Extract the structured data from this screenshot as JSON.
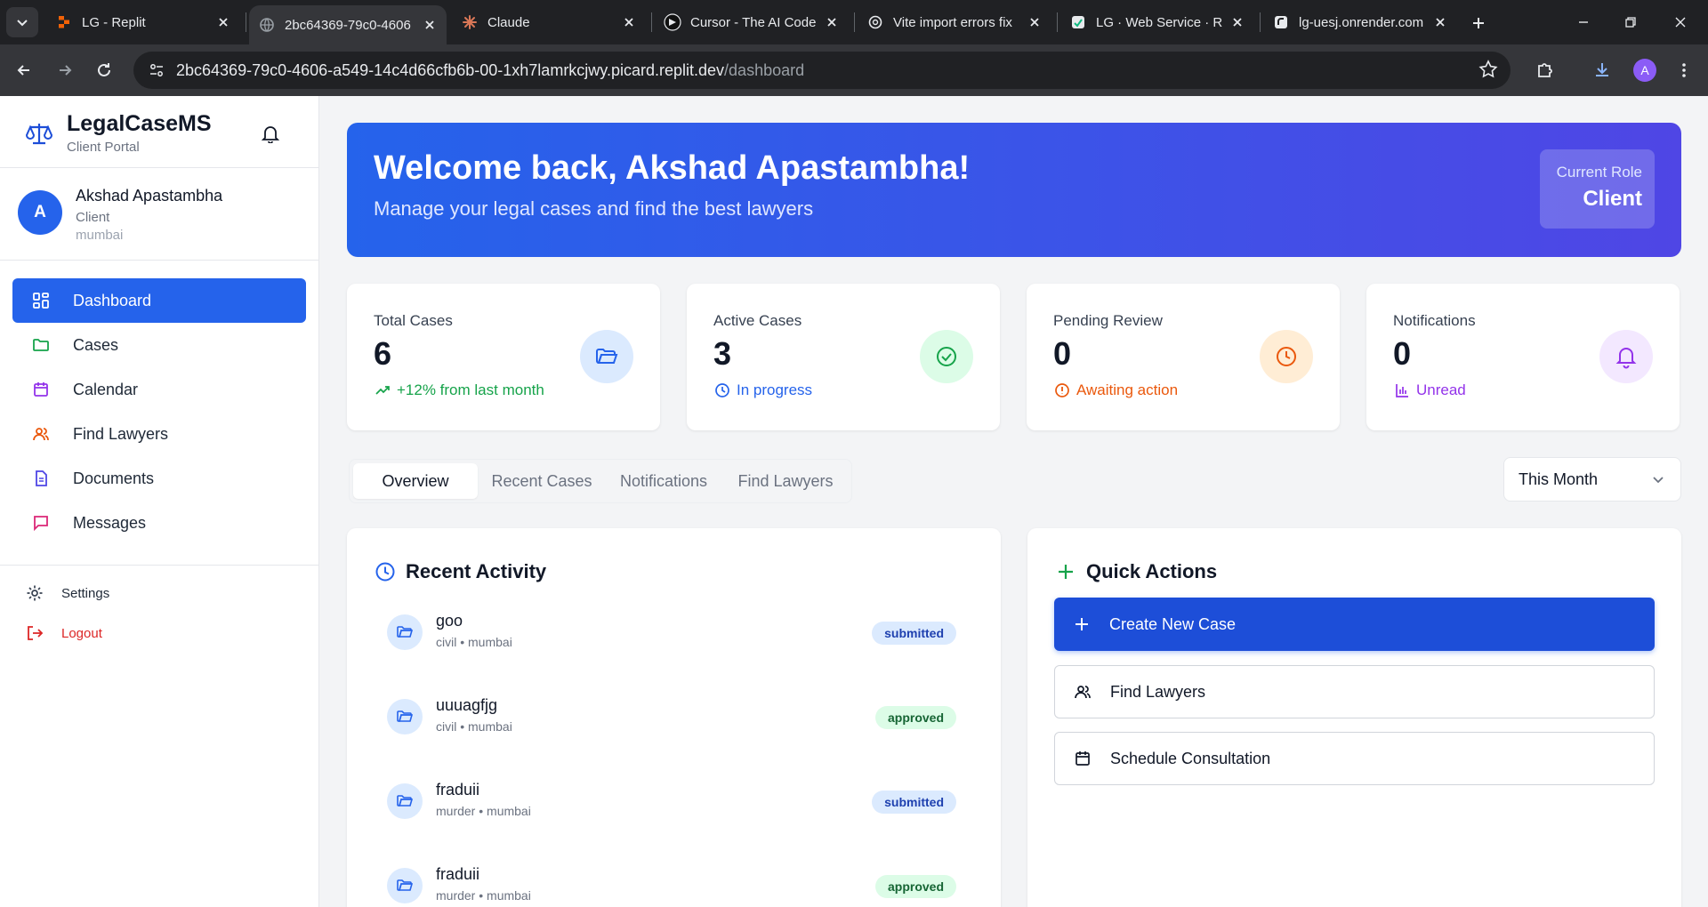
{
  "browser": {
    "tabs": [
      {
        "title": "LG - Replit",
        "icon": "replit-icon",
        "active": false
      },
      {
        "title": "2bc64369-79c0-4606",
        "icon": "globe-icon",
        "active": true
      },
      {
        "title": "Claude",
        "icon": "claude-icon",
        "active": false
      },
      {
        "title": "Cursor - The AI Code",
        "icon": "cursor-icon",
        "active": false
      },
      {
        "title": "Vite import errors fix",
        "icon": "openai-icon",
        "active": false
      },
      {
        "title": "LG · Web Service · R",
        "icon": "render-icon",
        "active": false
      },
      {
        "title": "lg-uesj.onrender.com",
        "icon": "render-icon",
        "active": false
      }
    ],
    "url_host": "2bc64369-79c0-4606-a549-14c4d66cfb6b-00-1xh7lamrkcjwy.picard.replit.dev",
    "url_path": "/dashboard",
    "profile_initial": "A"
  },
  "sidebar": {
    "brand_name": "LegalCaseMS",
    "brand_sub": "Client Portal",
    "user": {
      "initial": "A",
      "name": "Akshad Apastambha",
      "role": "Client",
      "location": "mumbai"
    },
    "nav": [
      {
        "label": "Dashboard",
        "icon": "grid-icon",
        "active": true
      },
      {
        "label": "Cases",
        "icon": "folder-icon",
        "active": false
      },
      {
        "label": "Calendar",
        "icon": "calendar-icon",
        "active": false
      },
      {
        "label": "Find Lawyers",
        "icon": "users-icon",
        "active": false
      },
      {
        "label": "Documents",
        "icon": "document-icon",
        "active": false
      },
      {
        "label": "Messages",
        "icon": "message-icon",
        "active": false
      }
    ],
    "settings_label": "Settings",
    "logout_label": "Logout"
  },
  "hero": {
    "title": "Welcome back, Akshad Apastambha!",
    "subtitle": "Manage your legal cases and find the best lawyers",
    "role_label": "Current Role",
    "role_value": "Client"
  },
  "stats": [
    {
      "label": "Total Cases",
      "value": "6",
      "foot": "+12% from last month",
      "foot_color": "#16a34a",
      "icon": "folder-open-icon",
      "icon_bg": "#dbeafe",
      "icon_color": "#2563eb"
    },
    {
      "label": "Active Cases",
      "value": "3",
      "foot": "In progress",
      "foot_color": "#2563eb",
      "icon": "check-circle-icon",
      "icon_bg": "#dcfce7",
      "icon_color": "#16a34a"
    },
    {
      "label": "Pending Review",
      "value": "0",
      "foot": "Awaiting action",
      "foot_color": "#ea580c",
      "icon": "clock-icon",
      "icon_bg": "#ffedd5",
      "icon_color": "#ea580c"
    },
    {
      "label": "Notifications",
      "value": "0",
      "foot": "Unread",
      "foot_color": "#9333ea",
      "icon": "bell-icon",
      "icon_bg": "#f3e8ff",
      "icon_color": "#9333ea"
    }
  ],
  "tabs": [
    "Overview",
    "Recent Cases",
    "Notifications",
    "Find Lawyers"
  ],
  "period_select": "This Month",
  "recent_activity": {
    "title": "Recent Activity",
    "items": [
      {
        "name": "goo",
        "meta": "civil • mumbai",
        "status": "submitted"
      },
      {
        "name": "uuuagfjg",
        "meta": "civil • mumbai",
        "status": "approved"
      },
      {
        "name": "fraduii",
        "meta": "murder • mumbai",
        "status": "submitted"
      },
      {
        "name": "fraduii",
        "meta": "murder • mumbai",
        "status": "approved"
      }
    ]
  },
  "quick_actions": {
    "title": "Quick Actions",
    "buttons": [
      {
        "label": "Create New Case",
        "icon": "plus-icon",
        "primary": true
      },
      {
        "label": "Find Lawyers",
        "icon": "users-icon",
        "primary": false
      },
      {
        "label": "Schedule Consultation",
        "icon": "calendar-icon",
        "primary": false
      }
    ]
  },
  "colors": {
    "primary": "#2563eb",
    "hero_start": "#2563eb",
    "hero_end": "#4f46e5",
    "logout": "#dc2626"
  }
}
